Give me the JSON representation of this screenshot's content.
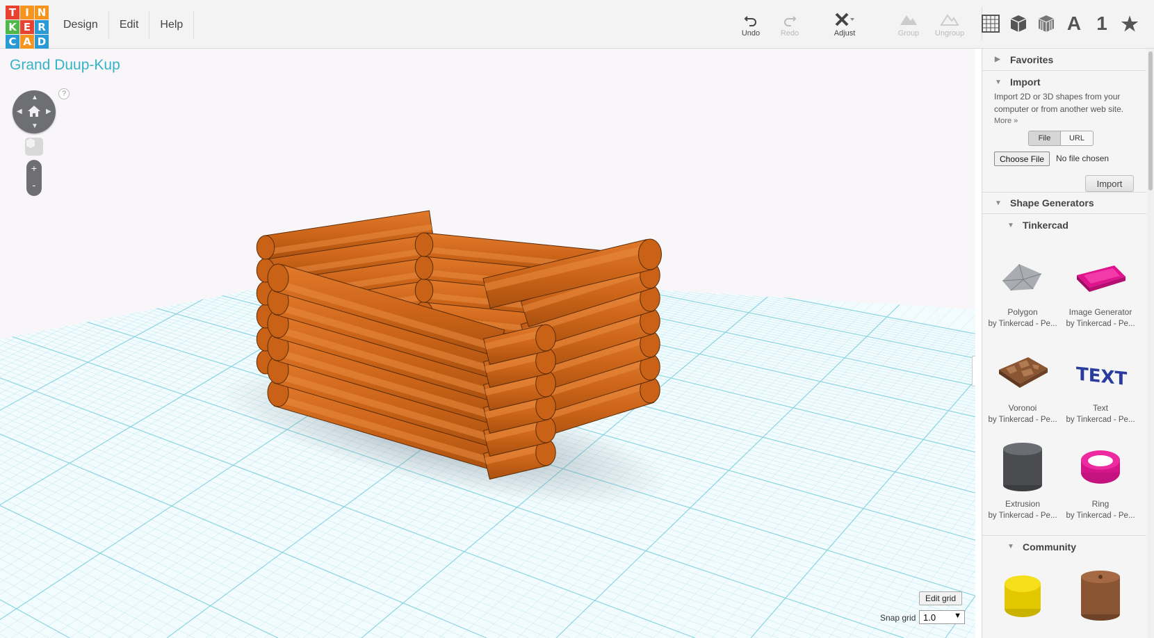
{
  "brand": {
    "logo_letters": [
      "T",
      "I",
      "N",
      "K",
      "E",
      "R",
      "C",
      "A",
      "D"
    ]
  },
  "menu": [
    "Design",
    "Edit",
    "Help"
  ],
  "toolbar": {
    "undo": "Undo",
    "redo": "Redo",
    "adjust": "Adjust",
    "group": "Group",
    "ungroup": "Ungroup"
  },
  "view_icons": [
    "grid-icon",
    "box-icon",
    "wireframe-box-icon",
    "letter-a-icon",
    "number-one-icon",
    "star-icon"
  ],
  "view_text": {
    "letter": "A",
    "number": "1",
    "star": "★"
  },
  "design": {
    "title": "Grand Duup-Kup"
  },
  "nav": {
    "help": "?",
    "zoom_in": "+",
    "zoom_out": "-"
  },
  "grid_controls": {
    "edit_grid": "Edit grid",
    "snap_label": "Snap grid",
    "snap_value": "1.0"
  },
  "panel_toggle": "❭",
  "sidebar": {
    "favorites": "Favorites",
    "import": {
      "title": "Import",
      "description": "Import 2D or 3D shapes from your computer or from another web site.",
      "more": "More »",
      "tabs": [
        "File",
        "URL"
      ],
      "choose_file": "Choose File",
      "no_file": "No file chosen",
      "button": "Import"
    },
    "shape_generators": "Shape Generators",
    "tinkercad_section": "Tinkercad",
    "community_section": "Community",
    "shapes": [
      {
        "name": "Polygon",
        "author": "by Tinkercad - Pe..."
      },
      {
        "name": "Image Generator",
        "author": "by Tinkercad - Pe..."
      },
      {
        "name": "Voronoi",
        "author": "by Tinkercad - Pe..."
      },
      {
        "name": "Text",
        "author": "by Tinkercad - Pe..."
      },
      {
        "name": "Extrusion",
        "author": "by Tinkercad - Pe..."
      },
      {
        "name": "Ring",
        "author": "by Tinkercad - Pe..."
      }
    ],
    "text_thumb": "TEXT"
  },
  "colors": {
    "accent": "#34b2c8",
    "logo": [
      "#e8412f",
      "#f7941e",
      "#f7941e",
      "#4db848",
      "#e8412f",
      "#2a9ad6",
      "#2a9ad6",
      "#f7941e",
      "#2a9ad6"
    ],
    "log_wood": "#cc6519",
    "grid_line": "#7fd0de"
  }
}
